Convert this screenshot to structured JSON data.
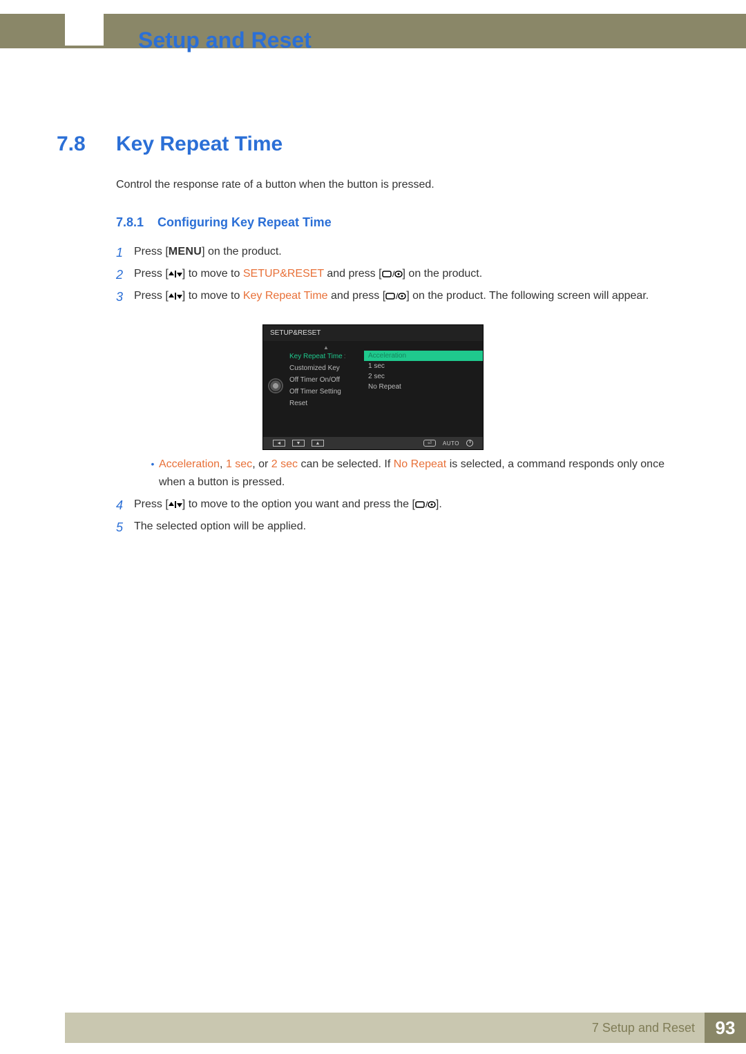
{
  "header": {
    "chapter_title": "Setup and Reset"
  },
  "section": {
    "number": "7.8",
    "title": "Key Repeat Time",
    "intro": "Control the response rate of a button when the button is pressed."
  },
  "subsection": {
    "number": "7.8.1",
    "title": "Configuring Key Repeat Time"
  },
  "steps": {
    "s1": {
      "num": "1",
      "pre": "Press [",
      "menu": "MENU",
      "post": "] on the product."
    },
    "s2": {
      "num": "2",
      "a": "Press [",
      "b": "] to move to ",
      "target": "SETUP&RESET",
      "c": " and press [",
      "d": "] on the product."
    },
    "s3": {
      "num": "3",
      "a": "Press [",
      "b": "] to move to ",
      "target": "Key Repeat Time",
      "c": " and press [",
      "d": "] on the product. The following screen will appear."
    },
    "s4": {
      "num": "4",
      "a": "Press [",
      "b": "] to move to the option you want and press the [",
      "c": "]."
    },
    "s5": {
      "num": "5",
      "text": "The selected option will be applied."
    }
  },
  "bullet": {
    "opt1": "Acceleration",
    "sep1": ", ",
    "opt2": "1 sec",
    "sep2": ", or ",
    "opt3": "2 sec",
    "mid": " can be selected. If ",
    "opt4": "No Repeat",
    "post": " is selected, a command responds only once when a button is pressed."
  },
  "osd": {
    "header": "SETUP&RESET",
    "menu": {
      "m0": "Key Repeat Time",
      "m1": "Customized Key",
      "m2": "Off Timer On/Off",
      "m3": "Off Timer Setting",
      "m4": "Reset"
    },
    "values": {
      "v0": "Acceleration",
      "v1": "1 sec",
      "v2": "2 sec",
      "v3": "No Repeat"
    },
    "auto": "AUTO"
  },
  "footer": {
    "chapter": "7 Setup and Reset",
    "page": "93"
  },
  "icons": {
    "updown": "▲/▼",
    "enter": "▭/⏎"
  }
}
